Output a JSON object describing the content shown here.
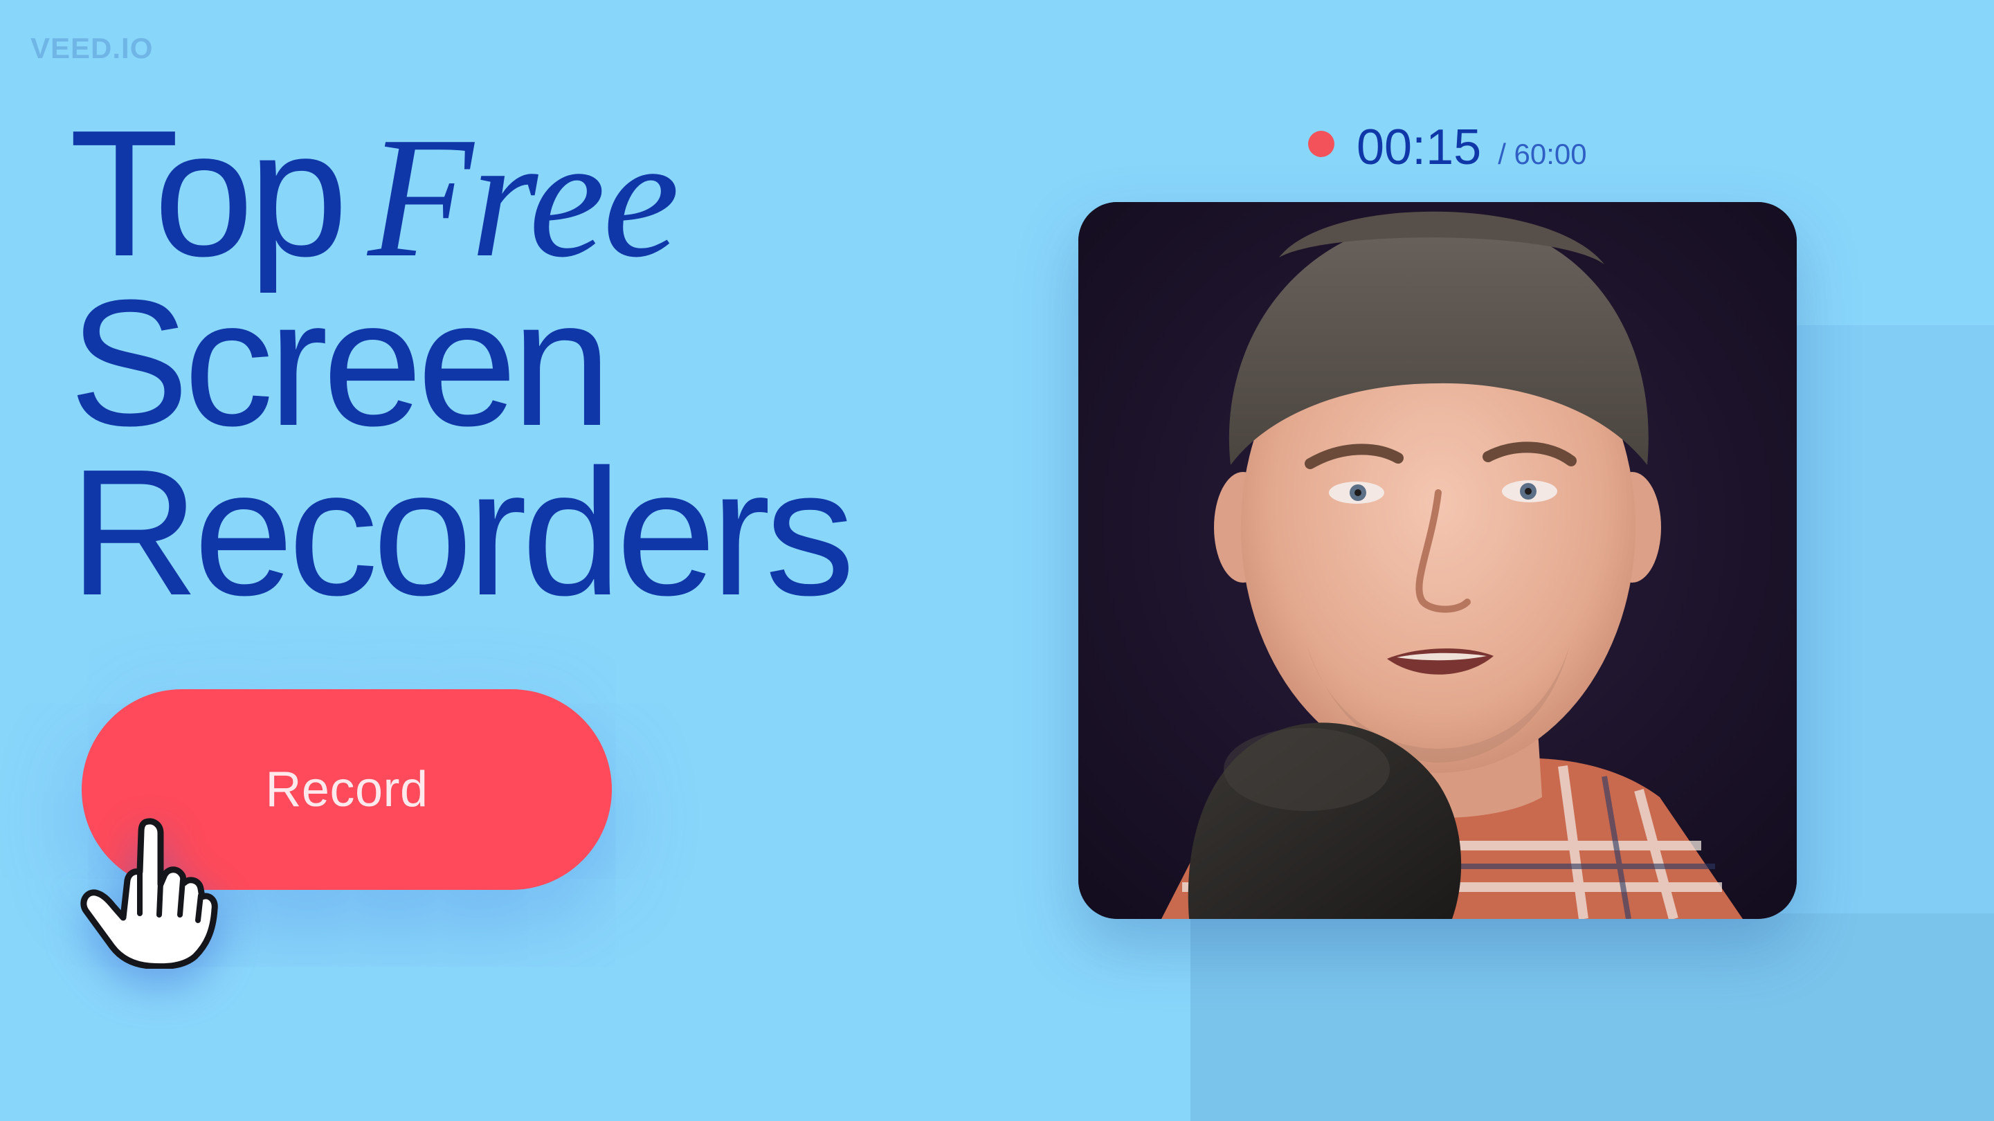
{
  "brand": {
    "name": "VEED.IO"
  },
  "headline": {
    "line1_word1": "Top",
    "line1_word2": "Free",
    "line2": "Screen",
    "line3": "Recorders"
  },
  "record_button": {
    "label": "Record"
  },
  "timer": {
    "elapsed": "00:15",
    "total": "/ 60:00"
  },
  "colors": {
    "background": "#89d6fb",
    "headline": "#0f37a8",
    "record_button": "#fe4a5a",
    "recording_dot": "#f4525a"
  },
  "icons": {
    "cursor": "hand-pointer-icon",
    "recording_indicator": "recording-dot-icon"
  }
}
